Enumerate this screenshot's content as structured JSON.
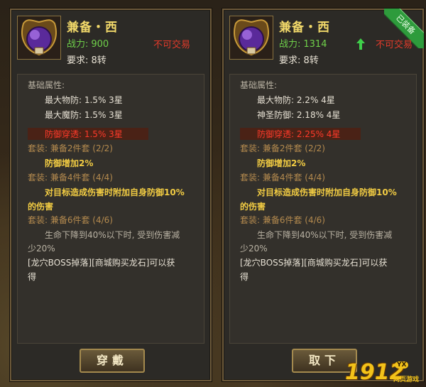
{
  "left_panel": {
    "item_name": "兼备・西",
    "power_label": "战力:",
    "power_value": "900",
    "trade_status": "不可交易",
    "requirement": "要求: 8转",
    "attr_header": "基础属性:",
    "attrs": [
      "最大物防: 1.5%  3星",
      "最大魔防: 1.5%  3星",
      "防御穿透: 1.5%  3星"
    ],
    "set2_header": "套装: 兼备2件套 (2/2)",
    "set2_effect": "防御增加2%",
    "set4_header": "套装: 兼备4件套 (4/4)",
    "set4_effect_line1": "对目标造成伤害时附加自身防御10%",
    "set4_effect_line2": "的伤害",
    "set6_header": "套装: 兼备6件套 (4/6)",
    "set6_effect_line1": "生命下降到40%以下时, 受到伤害减",
    "set6_effect_line2": "少20%",
    "source_line1": "[龙穴BOSS掉落][商城购买龙石]可以获",
    "source_line2": "得",
    "button_label": "穿戴"
  },
  "right_panel": {
    "ribbon": "已装备",
    "item_name": "兼备・西",
    "power_label": "战力:",
    "power_value": "1314",
    "trade_status": "不可交易",
    "requirement": "要求: 8转",
    "attr_header": "基础属性:",
    "attrs": [
      "最大物防: 2.2%  4星",
      "神圣防御: 2.18%  4星",
      "防御穿透: 2.25%  4星"
    ],
    "set2_header": "套装: 兼备2件套 (2/2)",
    "set2_effect": "防御增加2%",
    "set4_header": "套装: 兼备4件套 (4/4)",
    "set4_effect_line1": "对目标造成伤害时附加自身防御10%",
    "set4_effect_line2": "的伤害",
    "set6_header": "套装: 兼备6件套 (4/6)",
    "set6_effect_line1": "生命下降到40%以下时, 受到伤害减",
    "set6_effect_line2": "少20%",
    "source_line1": "[龙穴BOSS掉落][商城购买龙石]可以获",
    "source_line2": "得",
    "button_label": "取下"
  },
  "watermark": {
    "number": "1912",
    "badge": "YX",
    "subtitle": "网页游戏"
  },
  "colors": {
    "item_name": "#f2d96a",
    "power": "#6fd04a",
    "untradable": "#e23a2a",
    "set_effect": "#f2cc43",
    "set_header": "#b48a4e"
  }
}
